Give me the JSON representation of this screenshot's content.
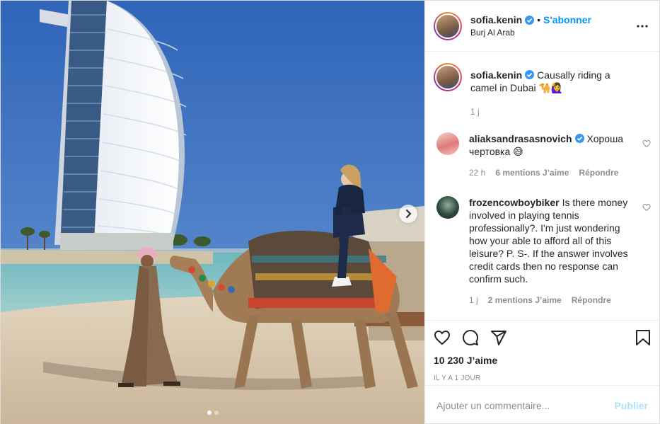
{
  "header": {
    "username": "sofia.kenin",
    "separator": "•",
    "follow_label": "S'abonner",
    "location": "Burj Al Arab"
  },
  "caption": {
    "username": "sofia.kenin",
    "text": "Causally riding a camel in Dubai 🐪🙋‍♀️",
    "time": "1 j"
  },
  "comments": [
    {
      "username": "aliaksandrasasnovich",
      "verified": true,
      "text": "Хороша чертовка 😅",
      "time": "22 h",
      "likes": "6 mentions J’aime",
      "reply": "Répondre"
    },
    {
      "username": "frozencowboybiker",
      "verified": false,
      "text": "Is there money involved in playing tennis professionally?. I'm just wondering how your able to afford all of this leisure? P. S-. If the answer involves credit cards then no response can confirm such.",
      "time": "1 j",
      "likes": "2 mentions J’aime",
      "reply": "Répondre"
    }
  ],
  "stats": {
    "likes": "10 230 J’aime",
    "time_ago": "IL Y A 1 JOUR"
  },
  "add_comment": {
    "placeholder": "Ajouter un commentaire...",
    "publish_label": "Publier"
  },
  "colors": {
    "accent": "#0095f6",
    "publish_disabled": "#b2dffc",
    "verified": "#3897f0",
    "sky": "#3d6fb6",
    "sand": "#d8c9b2"
  },
  "icons": [
    "verified-icon",
    "more-options-icon",
    "heart-icon",
    "comment-icon",
    "share-icon",
    "bookmark-icon",
    "chevron-right-icon"
  ],
  "carousel": {
    "slides": 2,
    "active": 1
  }
}
